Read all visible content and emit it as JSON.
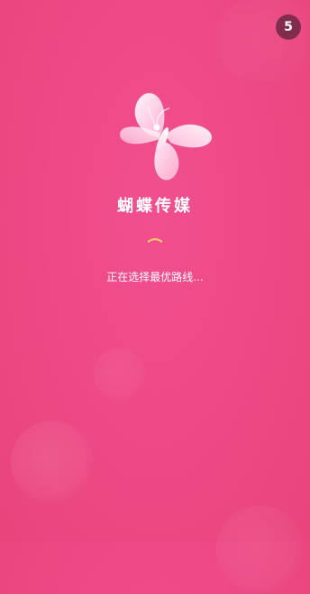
{
  "splash": {
    "countdown": "5",
    "app_name": "蝴蝶传媒",
    "status_text": "正在选择最优路线..."
  },
  "colors": {
    "background": "#ee4a86",
    "countdown_bg": "#5c223a",
    "spinner": "#ffd36b",
    "text": "#ffffff"
  },
  "icons": {
    "logo": "butterfly-icon"
  }
}
